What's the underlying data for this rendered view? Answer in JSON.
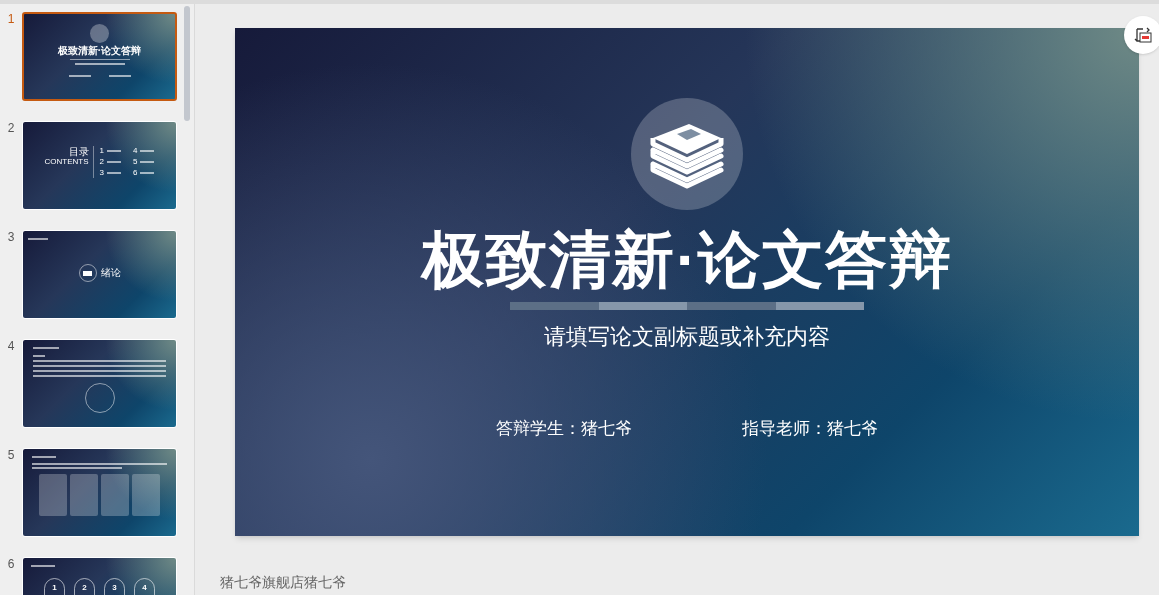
{
  "slides_panel": {
    "slides": [
      {
        "number": "1",
        "selected": true,
        "kind": "title",
        "title": "极致清新·论文答辩"
      },
      {
        "number": "2",
        "selected": false,
        "kind": "contents",
        "heading": "目录",
        "subheading": "CONTENTS",
        "items": [
          "1",
          "2",
          "3",
          "4",
          "5",
          "6"
        ]
      },
      {
        "number": "3",
        "selected": false,
        "kind": "section",
        "heading": "绪论"
      },
      {
        "number": "4",
        "selected": false,
        "kind": "text"
      },
      {
        "number": "5",
        "selected": false,
        "kind": "table"
      },
      {
        "number": "6",
        "selected": false,
        "kind": "steps",
        "items": [
          "1",
          "2",
          "3",
          "4"
        ]
      }
    ]
  },
  "slide": {
    "title": "极致清新·论文答辩",
    "subtitle": "请填写论文副标题或补充内容",
    "fields": [
      "答辩学生：猪七爷",
      "指导老师：猪七爷"
    ]
  },
  "notes": "猪七爷旗舰店猪七爷"
}
